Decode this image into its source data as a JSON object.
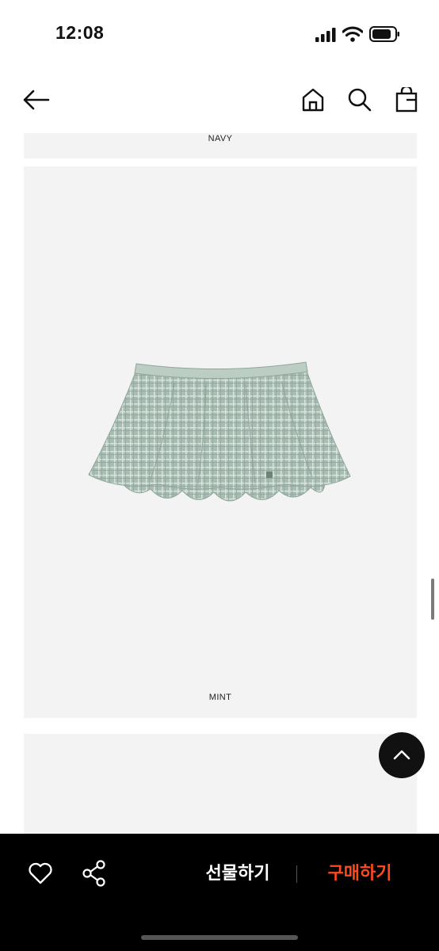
{
  "status_bar": {
    "time": "12:08",
    "icons": [
      "signal-icon",
      "wifi-icon",
      "battery-icon"
    ]
  },
  "header": {
    "icons": [
      "back-arrow-icon",
      "home-icon",
      "search-icon",
      "shopping-bag-icon"
    ]
  },
  "product_gallery": {
    "items": [
      {
        "label": "NAVY"
      },
      {
        "label": "MINT",
        "image": "mint-check-skirt"
      },
      {
        "label": ""
      }
    ]
  },
  "scroll_top_icon": "chevron-up-icon",
  "bottom_bar": {
    "wishlist_icon": "heart-icon",
    "share_icon": "share-icon",
    "gift_label": "선물하기",
    "buy_label": "구매하기"
  },
  "colors": {
    "accent": "#ff4a1c",
    "bottom_bar_bg": "#000000",
    "card_bg": "#f3f3f3"
  }
}
